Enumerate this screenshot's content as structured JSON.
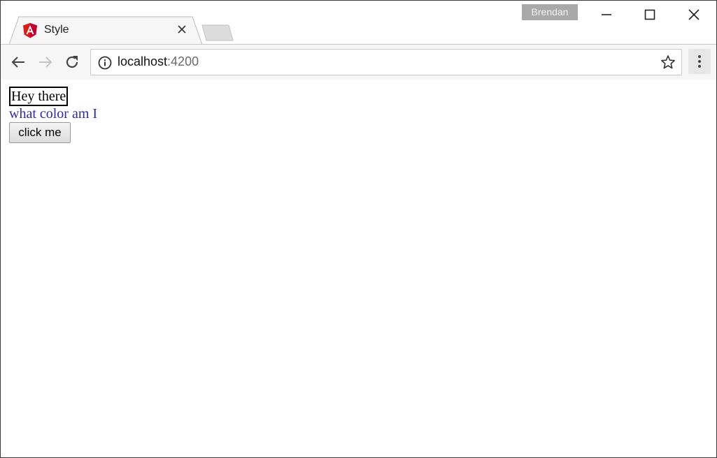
{
  "tab": {
    "title": "Style",
    "favicon": "angular-logo-icon"
  },
  "profile": {
    "name": "Brendan"
  },
  "address": {
    "host": "localhost",
    "port": ":4200"
  },
  "page": {
    "greeting": "Hey there",
    "color_question": "what color am I",
    "button_label": "click me"
  },
  "colors": {
    "text_blue": "#2b2ba6",
    "angular_red": "#dd1b16"
  }
}
